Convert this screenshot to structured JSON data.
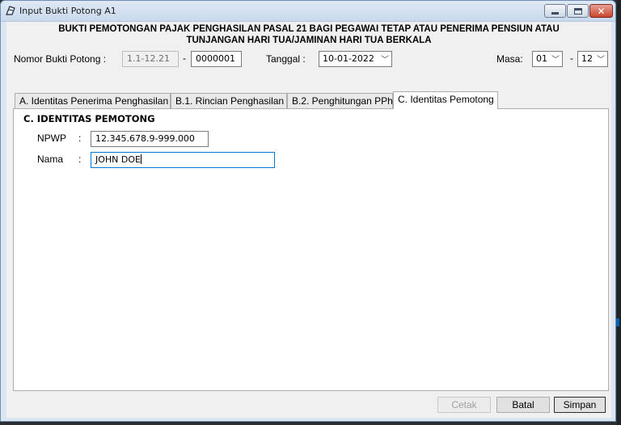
{
  "window": {
    "title": "Input Bukti Potong A1",
    "close_glyph": "✕"
  },
  "header": {
    "line1": "BUKTI PEMOTONGAN PAJAK PENGHASILAN PASAL 21 BAGI PEGAWAI TETAP ATAU PENERIMA PENSIUN ATAU",
    "line2": "TUNJANGAN HARI TUA/JAMINAN HARI TUA BERKALA"
  },
  "nomor": {
    "label": "Nomor Bukti Potong :",
    "prefix": "1.1-12.21",
    "dash": "-",
    "value": "0000001"
  },
  "tanggal": {
    "label": "Tanggal :",
    "value": "10-01-2022"
  },
  "masa": {
    "label": "Masa:",
    "from": "01",
    "dash": "-",
    "to": "12"
  },
  "tabs": [
    {
      "label": "A. Identitas Penerima Penghasilan"
    },
    {
      "label": "B.1. Rincian Penghasilan"
    },
    {
      "label": "B.2. Penghitungan PPh"
    },
    {
      "label": "C. Identitas Pemotong"
    }
  ],
  "section": {
    "title": "C. IDENTITAS PEMOTONG",
    "npwp_label": "NPWP",
    "npwp_value": "12.345.678.9-999.000",
    "nama_label": "Nama",
    "nama_value": "JOHN DOE",
    "colon": ":"
  },
  "buttons": {
    "cetak": "Cetak",
    "batal": "Batal",
    "simpan": "Simpan"
  },
  "icons": {
    "chevron": "chevron-down-icon"
  }
}
